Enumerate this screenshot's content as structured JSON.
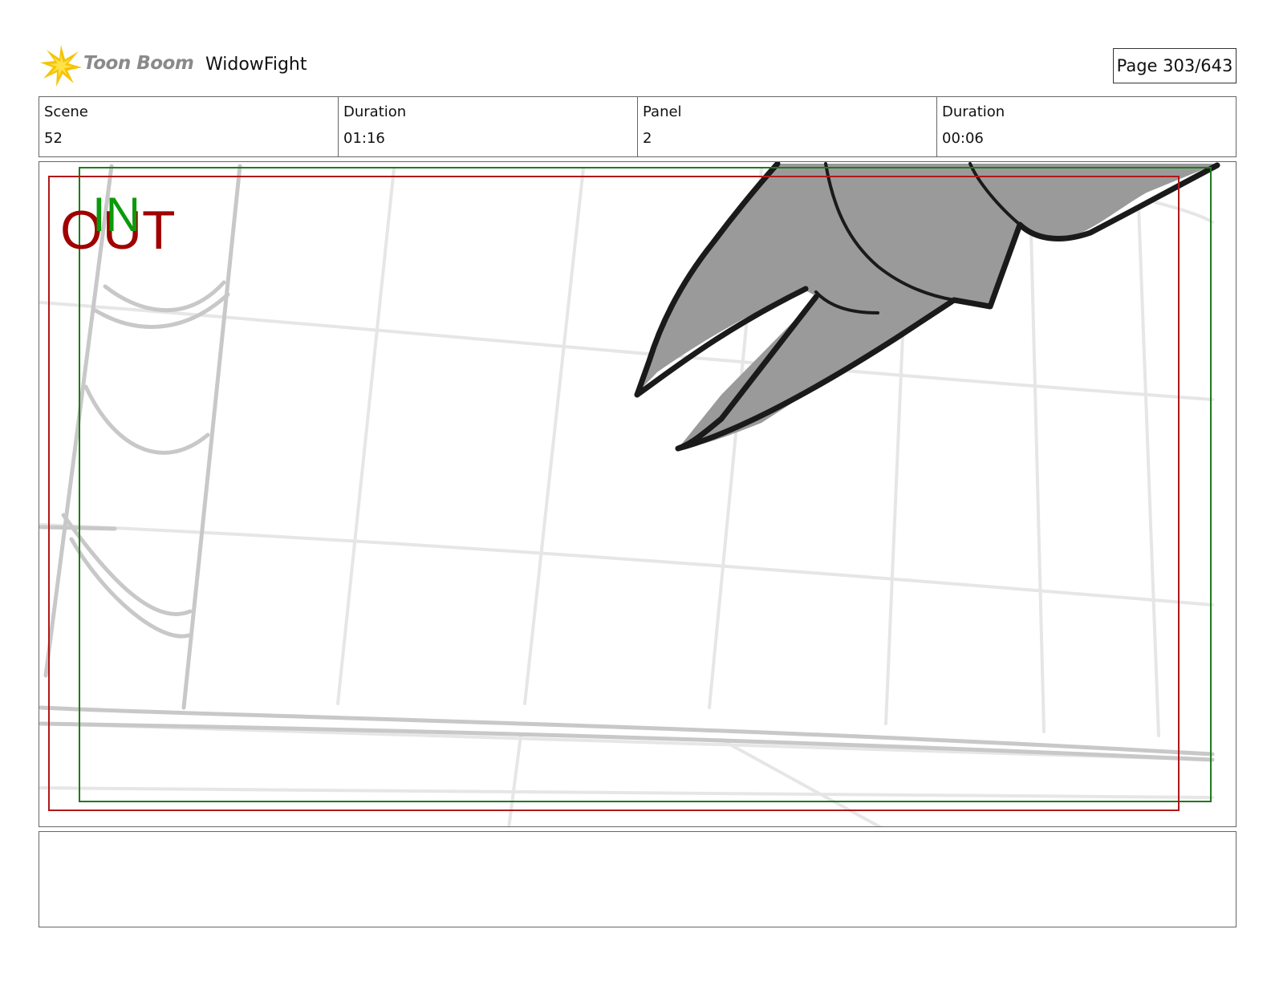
{
  "header": {
    "logo_text": "Toon Boom",
    "project_title": "WidowFight",
    "page_label": "Page 303/643"
  },
  "info": {
    "scene_label": "Scene",
    "scene_value": "52",
    "scene_duration_label": "Duration",
    "scene_duration_value": "01:16",
    "panel_label": "Panel",
    "panel_value": "2",
    "panel_duration_label": "Duration",
    "panel_duration_value": "00:06"
  },
  "panel": {
    "in_marker": "IN",
    "out_marker": "OUT",
    "in_color": "#0a9a0a",
    "out_color": "#a00000",
    "in_frame_color": "#1e7a1e",
    "out_frame_color": "#b01818"
  },
  "notes": {
    "text": ""
  }
}
